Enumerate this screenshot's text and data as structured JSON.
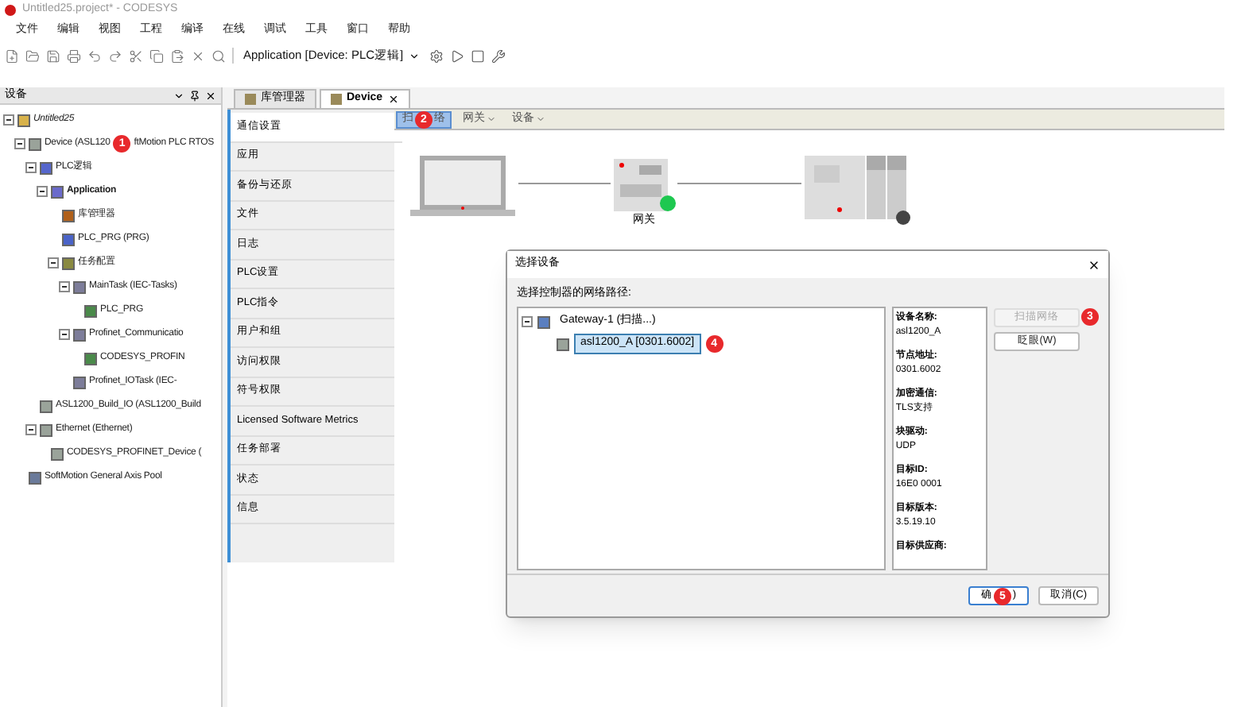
{
  "window": {
    "title": "Untitled25.project* - CODESYS"
  },
  "menu": [
    "文件",
    "编辑",
    "视图",
    "工程",
    "编译",
    "在线",
    "调试",
    "工具",
    "窗口",
    "帮助"
  ],
  "toolbar": {
    "application": "Application [Device: PLC逻辑]"
  },
  "devices_panel": {
    "title": "设备",
    "tree": [
      {
        "label": "Untitled25",
        "kind": "project",
        "italic": true,
        "expanded": true,
        "children": [
          {
            "label": "Device (ASL120",
            "badge": "1",
            "label_tail": "ftMotion PLC RTOS",
            "kind": "device",
            "expanded": true,
            "children": [
              {
                "label": "PLC逻辑",
                "kind": "logic",
                "expanded": true,
                "children": [
                  {
                    "label": "Application",
                    "kind": "app",
                    "bold": true,
                    "expanded": true,
                    "children": [
                      {
                        "label": "库管理器",
                        "kind": "library"
                      },
                      {
                        "label": "PLC_PRG (PRG)",
                        "kind": "pou"
                      },
                      {
                        "label": "任务配置",
                        "kind": "taskconfig",
                        "expanded": true,
                        "children": [
                          {
                            "label": "MainTask (IEC-Tasks)",
                            "kind": "task",
                            "expanded": true,
                            "children": [
                              {
                                "label": "PLC_PRG",
                                "kind": "call"
                              }
                            ]
                          },
                          {
                            "label": "Profinet_Communicatio",
                            "kind": "task",
                            "expanded": true,
                            "children": [
                              {
                                "label": "CODESYS_PROFIN",
                                "kind": "call"
                              }
                            ]
                          },
                          {
                            "label": "Profinet_IOTask (IEC-",
                            "kind": "task"
                          }
                        ]
                      }
                    ]
                  }
                ]
              },
              {
                "label": "ASL1200_Build_IO (ASL1200_Build",
                "kind": "device"
              },
              {
                "label": "Ethernet (Ethernet)",
                "kind": "device",
                "expanded": true,
                "children": [
                  {
                    "label": "CODESYS_PROFINET_Device (",
                    "kind": "device"
                  }
                ]
              }
            ]
          },
          {
            "label": "SoftMotion General Axis Pool",
            "kind": "axis"
          }
        ]
      }
    ]
  },
  "editor_tabs": [
    {
      "label": "库管理器",
      "selected": false
    },
    {
      "label": "Device",
      "selected": true
    }
  ],
  "device_nav": [
    {
      "label": "通信设置",
      "selected": true
    },
    {
      "label": "应用",
      "selected": false
    },
    {
      "label": "备份与还原",
      "selected": false
    },
    {
      "label": "文件",
      "selected": false
    },
    {
      "label": "日志",
      "selected": false
    },
    {
      "label": "PLC设置",
      "selected": false
    },
    {
      "label": "PLC指令",
      "selected": false
    },
    {
      "label": "用户和组",
      "selected": false
    },
    {
      "label": "访问权限",
      "selected": false
    },
    {
      "label": "符号权限",
      "selected": false
    },
    {
      "label": "Licensed Software Metrics",
      "selected": false
    },
    {
      "label": "任务部署",
      "selected": false
    },
    {
      "label": "状态",
      "selected": false
    },
    {
      "label": "信息",
      "selected": false
    }
  ],
  "comm_toolbar": [
    {
      "label": "扫",
      "badge": "2",
      "label_tail": "络",
      "kind": "button",
      "selected": true
    },
    {
      "label": "网关",
      "kind": "dropdown",
      "selected": false
    },
    {
      "label": "设备",
      "kind": "dropdown",
      "selected": false
    }
  ],
  "diagram": {
    "gateway_label": "网关"
  },
  "dialog": {
    "title": "选择设备",
    "path_label": "选择控制器的网络路径:",
    "tree": [
      {
        "label": "Gateway-1 (扫描...)",
        "kind": "gateway",
        "expanded": true,
        "selected": false,
        "children": [
          {
            "label": "asl1200_A [0301.6002]",
            "kind": "device",
            "selected": true,
            "badge": "4"
          }
        ]
      }
    ],
    "info": [
      {
        "name": "设备名称:",
        "value": "asl1200_A"
      },
      {
        "name": "节点地址:",
        "value": "0301.6002"
      },
      {
        "name": "加密通信:",
        "value": "TLS支持"
      },
      {
        "name": "块驱动:",
        "value": "UDP"
      },
      {
        "name": "目标ID:",
        "value": "16E0 0001"
      },
      {
        "name": "目标版本:",
        "value": "3.5.19.10"
      },
      {
        "name": "目标供应商:"
      }
    ],
    "side_buttons": [
      {
        "label": "扫描网络",
        "badge": "3",
        "disabled": true
      },
      {
        "label": "眨眼(W)",
        "disabled": false
      }
    ],
    "footer_buttons": [
      {
        "label": "确",
        "badge": "5",
        "label_tail": ")",
        "primary": true
      },
      {
        "label": "取消(C)",
        "primary": false
      }
    ]
  }
}
